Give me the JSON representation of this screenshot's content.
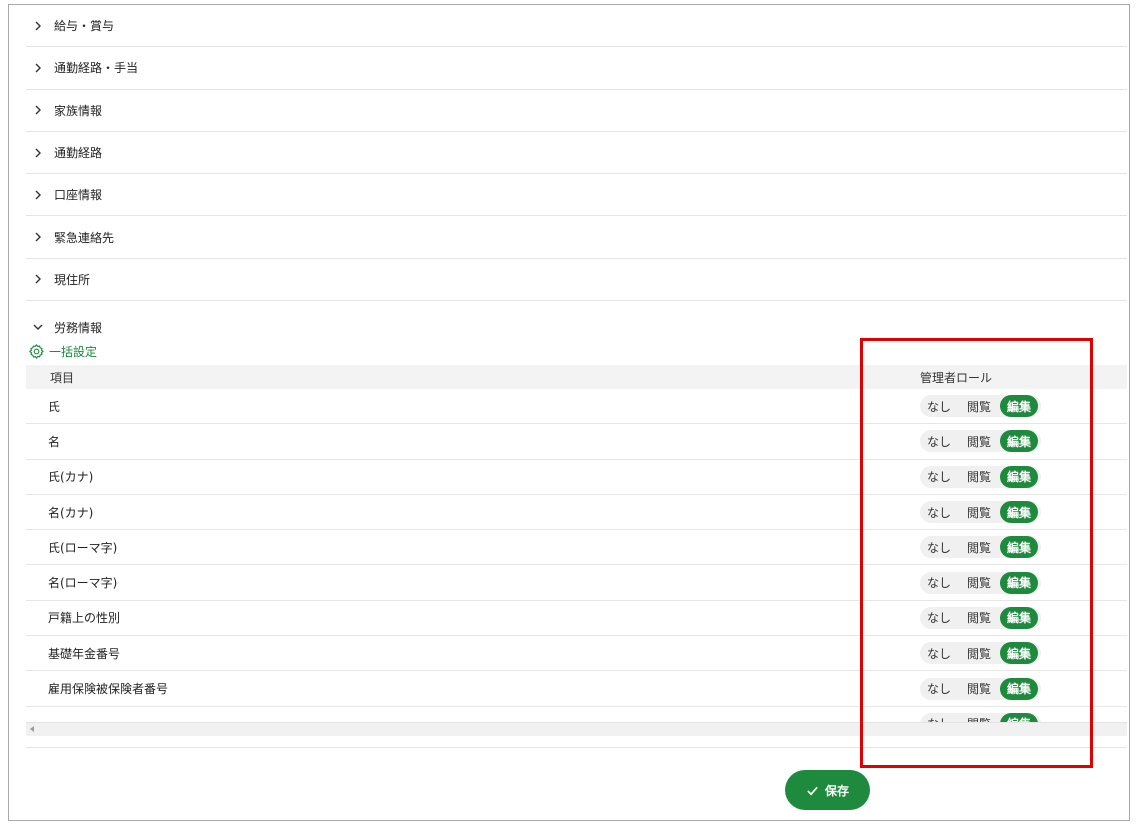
{
  "sections": [
    {
      "label": "給与・賞与",
      "icon": "chevron-right-icon"
    },
    {
      "label": "通勤経路・手当",
      "icon": "chevron-right-icon"
    },
    {
      "label": "家族情報",
      "icon": "chevron-right-icon"
    },
    {
      "label": "通勤経路",
      "icon": "chevron-right-icon"
    },
    {
      "label": "口座情報",
      "icon": "chevron-right-icon"
    },
    {
      "label": "緊急連絡先",
      "icon": "chevron-right-icon"
    },
    {
      "label": "現住所",
      "icon": "chevron-right-icon"
    }
  ],
  "expanded_section": {
    "label": "労務情報",
    "icon": "chevron-down-icon"
  },
  "bulk_setting": {
    "label": "一括設定",
    "icon": "gear-icon"
  },
  "table": {
    "headers": {
      "item": "項目",
      "role": "管理者ロール"
    },
    "role_options": {
      "none": "なし",
      "view": "閲覧",
      "edit": "編集"
    },
    "rows": [
      {
        "item": "氏",
        "selected": "edit"
      },
      {
        "item": "名",
        "selected": "edit"
      },
      {
        "item": "氏(カナ)",
        "selected": "edit"
      },
      {
        "item": "名(カナ)",
        "selected": "edit"
      },
      {
        "item": "氏(ローマ字)",
        "selected": "edit"
      },
      {
        "item": "名(ローマ字)",
        "selected": "edit"
      },
      {
        "item": "戸籍上の性別",
        "selected": "edit"
      },
      {
        "item": "基礎年金番号",
        "selected": "edit"
      },
      {
        "item": "雇用保険被保険者番号",
        "selected": "edit"
      },
      {
        "item": "",
        "selected": "edit"
      }
    ]
  },
  "save_button": {
    "label": "保存",
    "icon": "check-icon"
  },
  "colors": {
    "accent": "#1e8a3e",
    "highlight": "#e00000"
  }
}
